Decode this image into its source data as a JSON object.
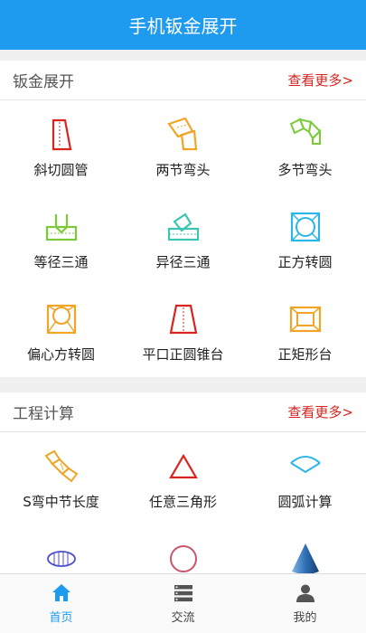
{
  "header": {
    "title": "手机钣金展开"
  },
  "section1": {
    "title": "钣金展开",
    "more": "查看更多>",
    "items": [
      {
        "label": "斜切圆管",
        "icon": "slanted-pipe-icon"
      },
      {
        "label": "两节弯头",
        "icon": "two-section-elbow-icon"
      },
      {
        "label": "多节弯头",
        "icon": "multi-section-elbow-icon"
      },
      {
        "label": "等径三通",
        "icon": "equal-tee-icon"
      },
      {
        "label": "异径三通",
        "icon": "reducing-tee-icon"
      },
      {
        "label": "正方转圆",
        "icon": "square-to-round-icon"
      },
      {
        "label": "偏心方转圆",
        "icon": "eccentric-square-to-round-icon"
      },
      {
        "label": "平口正圆锥台",
        "icon": "flat-frustum-cone-icon"
      },
      {
        "label": "正矩形台",
        "icon": "rectangular-frustum-icon"
      }
    ]
  },
  "section2": {
    "title": "工程计算",
    "more": "查看更多>",
    "items": [
      {
        "label": "S弯中节长度",
        "icon": "s-bend-icon"
      },
      {
        "label": "任意三角形",
        "icon": "triangle-icon"
      },
      {
        "label": "圆弧计算",
        "icon": "arc-icon"
      },
      {
        "label": "",
        "icon": "ellipse-icon"
      },
      {
        "label": "",
        "icon": "circle-icon"
      },
      {
        "label": "",
        "icon": "cone-icon"
      }
    ]
  },
  "tabs": [
    {
      "label": "首页",
      "icon": "home-icon",
      "active": true
    },
    {
      "label": "交流",
      "icon": "list-icon",
      "active": false
    },
    {
      "label": "我的",
      "icon": "user-icon",
      "active": false
    }
  ],
  "colors": {
    "primary": "#1e9bef",
    "more": "#d9241f"
  }
}
